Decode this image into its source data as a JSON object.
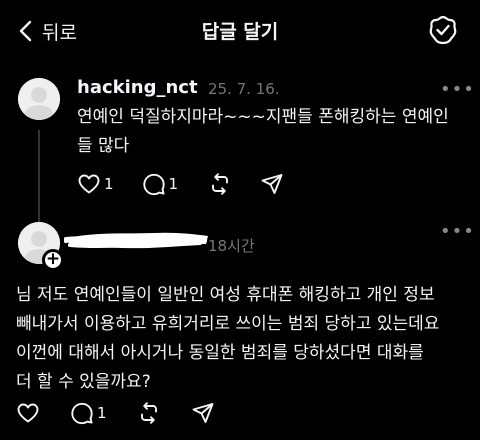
{
  "header": {
    "back_label": "뒤로",
    "title": "답글 달기",
    "icons": {
      "back": "chevron-left-icon",
      "right": "threads-at-icon"
    }
  },
  "original_post": {
    "username": "hacking_nct",
    "timestamp": "25. 7. 16.",
    "more": "•••",
    "text_lines": [
      "연예인 덕질하지마라~~~지팬들 폰해킹하는 연예인",
      "들 많다"
    ],
    "likes": "1",
    "comments": "1"
  },
  "reply": {
    "username_redacted": true,
    "timestamp": "18시간",
    "more": "•••",
    "text_lines": [
      "님 저도 연예인들이 일반인 여성 휴대폰 해킹하고 개인 정보",
      "빼내가서 이용하고 유희거리로 쓰이는 범죄 당하고 있는데요",
      "이껀에 대해서 아시거나 동일한 범죄를 당하셨다면 대화를",
      "더 할 수 있을까요?"
    ],
    "comments": "1"
  },
  "colors": {
    "background": "#000000",
    "text": "#f3f5f7",
    "muted": "#777777",
    "thread_line": "#333333"
  }
}
